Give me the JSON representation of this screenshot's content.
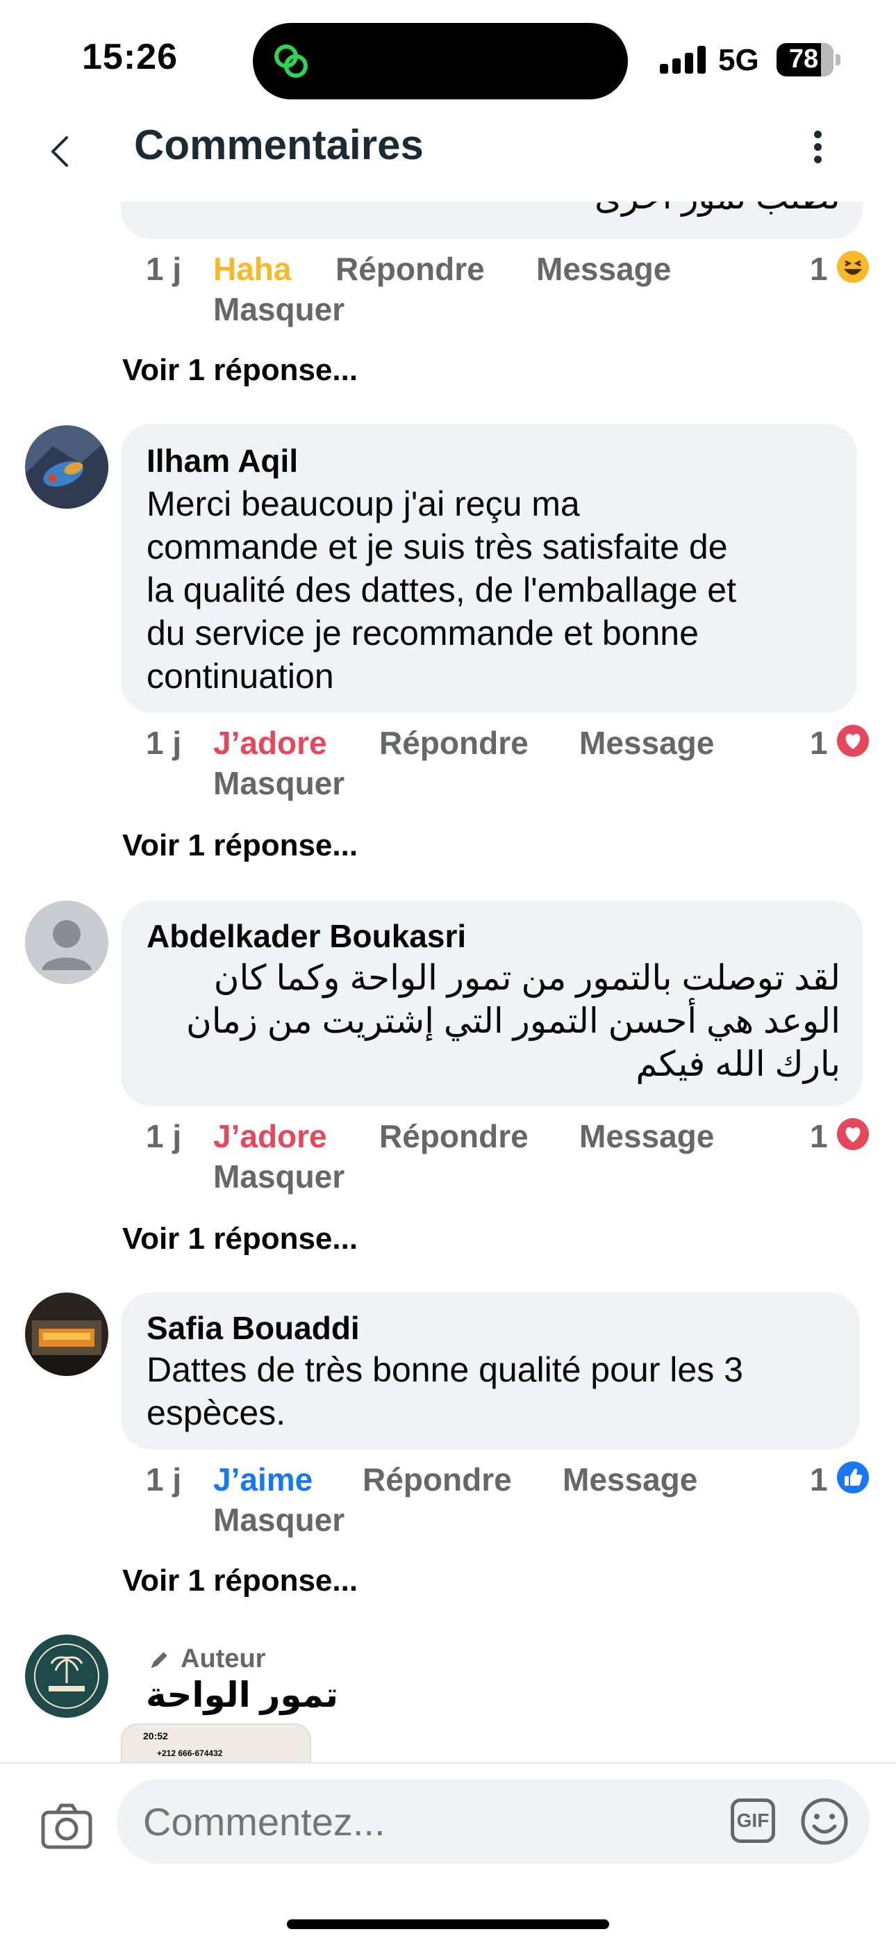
{
  "status": {
    "time": "15:26",
    "network": "5G",
    "battery": "78",
    "battery_level": 0.78
  },
  "header": {
    "title": "Commentaires"
  },
  "partial_comment": {
    "text": "لطلب تمور أخرى",
    "time": "1 j",
    "reaction_label": "Haha",
    "reply": "Répondre",
    "message": "Message",
    "hide": "Masquer",
    "reaction_count": "1",
    "reaction_icon": "haha-icon",
    "voir": "Voir 1 réponse..."
  },
  "comments": [
    {
      "author": "Ilham Aqil",
      "lines": [
        "Merci beaucoup j'ai reçu ma",
        "commande et je suis très satisfaite de",
        "la qualité des dattes, de l'emballage et",
        "du service je recommande et bonne",
        "continuation"
      ],
      "time": "1 j",
      "reaction_label": "J’adore",
      "reaction_color": "#e4485a",
      "reply": "Répondre",
      "message": "Message",
      "hide": "Masquer",
      "reaction_count": "1",
      "reaction_icon": "love-icon",
      "voir": "Voir 1 réponse..."
    },
    {
      "author": "Abdelkader Boukasri",
      "lines": [
        "لقد توصلت بالتمور من تمور الواحة وكما كان",
        "الوعد هي  أحسن التمور التي إشتريت من زمان",
        "بارك الله فيكم"
      ],
      "time": "1 j",
      "reaction_label": "J’adore",
      "reaction_color": "#e4485a",
      "reply": "Répondre",
      "message": "Message",
      "hide": "Masquer",
      "reaction_count": "1",
      "reaction_icon": "love-icon",
      "voir": "Voir 1 réponse..."
    },
    {
      "author": "Safia Bouaddi",
      "lines": [
        "Dattes de très bonne qualité pour les 3",
        "espèces."
      ],
      "time": "1 j",
      "reaction_label": "J’aime",
      "reaction_color": "#1877f2",
      "reply": "Répondre",
      "message": "Message",
      "hide": "Masquer",
      "reaction_count": "1",
      "reaction_icon": "like-icon",
      "voir": "Voir 1 réponse..."
    }
  ],
  "author_reply": {
    "badge": "Auteur",
    "name": "تمور الواحة",
    "thumb_time": "20:52",
    "thumb_phone": "+212 666-674432"
  },
  "composer": {
    "placeholder": "Commentez...",
    "gif_label": "GIF"
  },
  "colors": {
    "haha": "#f7b928",
    "love": "#e4485a",
    "like": "#1877f2",
    "muted": "#65676b",
    "bubble": "#f0f2f5"
  }
}
